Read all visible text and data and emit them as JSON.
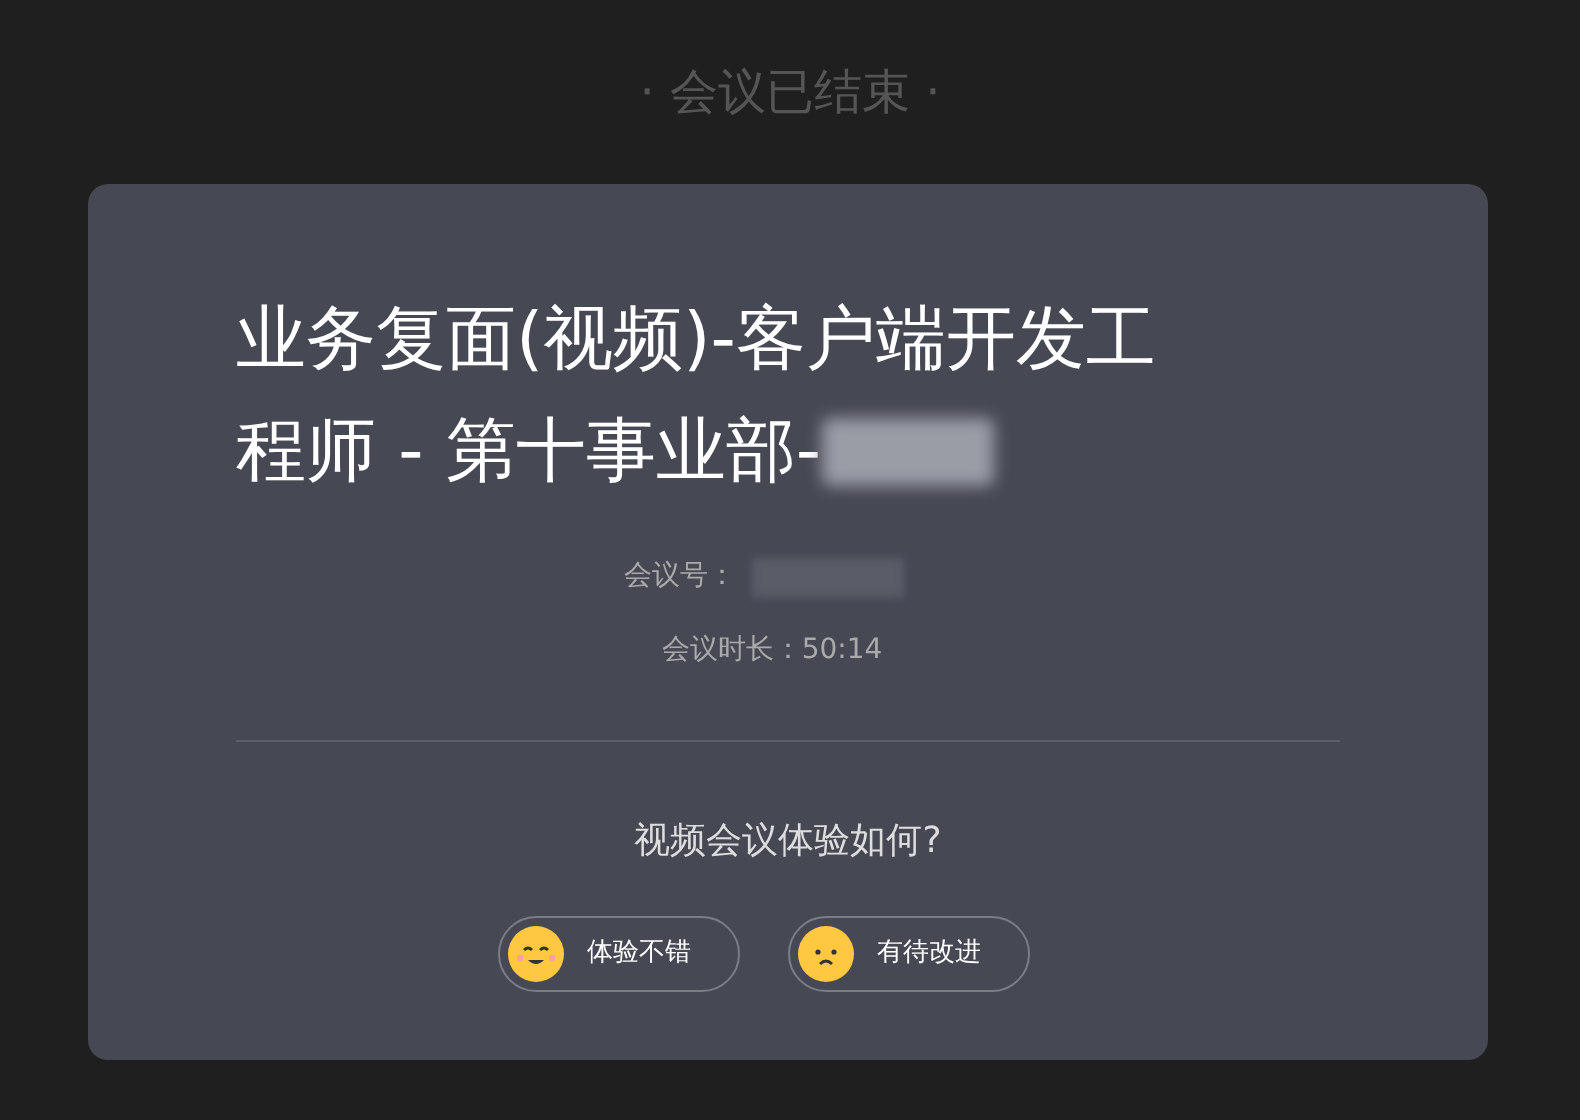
{
  "header": {
    "title": "· 会议已结束 ·"
  },
  "meeting": {
    "title_lines": [
      "业务复面(视频)-客户端开发工",
      "程师 - 第十事业部-"
    ],
    "number_label": "会议号：",
    "duration": "会议时长：50:14"
  },
  "feedback": {
    "question": "视频会议体验如何?",
    "options": [
      {
        "kind": "happy",
        "label": "体验不错"
      },
      {
        "kind": "sad",
        "label": "有待改进"
      }
    ]
  }
}
